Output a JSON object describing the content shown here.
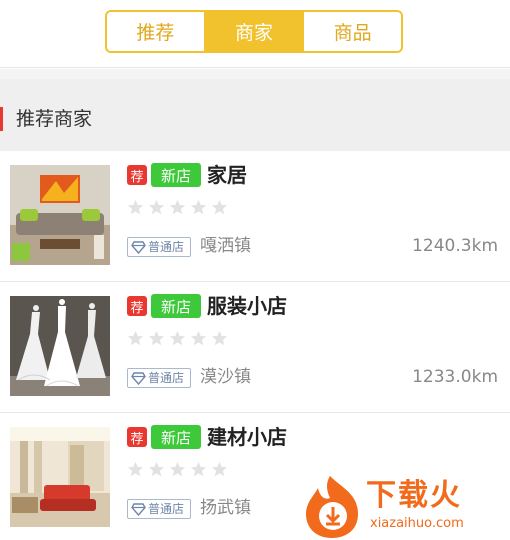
{
  "tabs": [
    {
      "label": "推荐",
      "active": false
    },
    {
      "label": "商家",
      "active": true
    },
    {
      "label": "商品",
      "active": false
    }
  ],
  "section": {
    "title": "推荐商家"
  },
  "merchants": [
    {
      "recommend_tag": "荐",
      "new_tag": "新店",
      "name": "家居",
      "rating": 0,
      "store_type": "普通店",
      "town": "嘎洒镇",
      "distance": "1240.3km",
      "image": "living-room-photo"
    },
    {
      "recommend_tag": "荐",
      "new_tag": "新店",
      "name": "服装小店",
      "rating": 0,
      "store_type": "普通店",
      "town": "漠沙镇",
      "distance": "1233.0km",
      "image": "dress-mannequins-photo"
    },
    {
      "recommend_tag": "荐",
      "new_tag": "新店",
      "name": "建材小店",
      "rating": 0,
      "store_type": "普通店",
      "town": "扬武镇",
      "distance": "",
      "image": "showroom-photo"
    }
  ],
  "watermark": {
    "big": "下载火",
    "small": "xiazaihuo.com"
  },
  "colors": {
    "accent": "#f2c12e",
    "tag_red": "#e8382f",
    "tag_green": "#3ec93a",
    "badge_blue": "#6e86a8"
  }
}
